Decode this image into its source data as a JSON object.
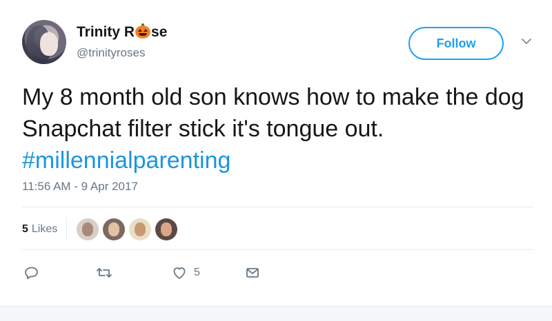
{
  "tweet": {
    "author": {
      "name_prefix": "Trinity R",
      "name_suffix": "se",
      "handle": "@trinityroses"
    },
    "follow_label": "Follow",
    "text": "My 8 month old son knows how to make the dog Snapchat filter stick it's tongue out.",
    "hashtag": "#millennialparenting",
    "timestamp": "11:56 AM - 9 Apr 2017",
    "likes": {
      "count": "5",
      "label": "Likes"
    },
    "actions": {
      "like_count": "5"
    },
    "colors": {
      "accent": "#1da1f2",
      "hashtag": "#1b95e0",
      "muted": "#657786"
    }
  }
}
